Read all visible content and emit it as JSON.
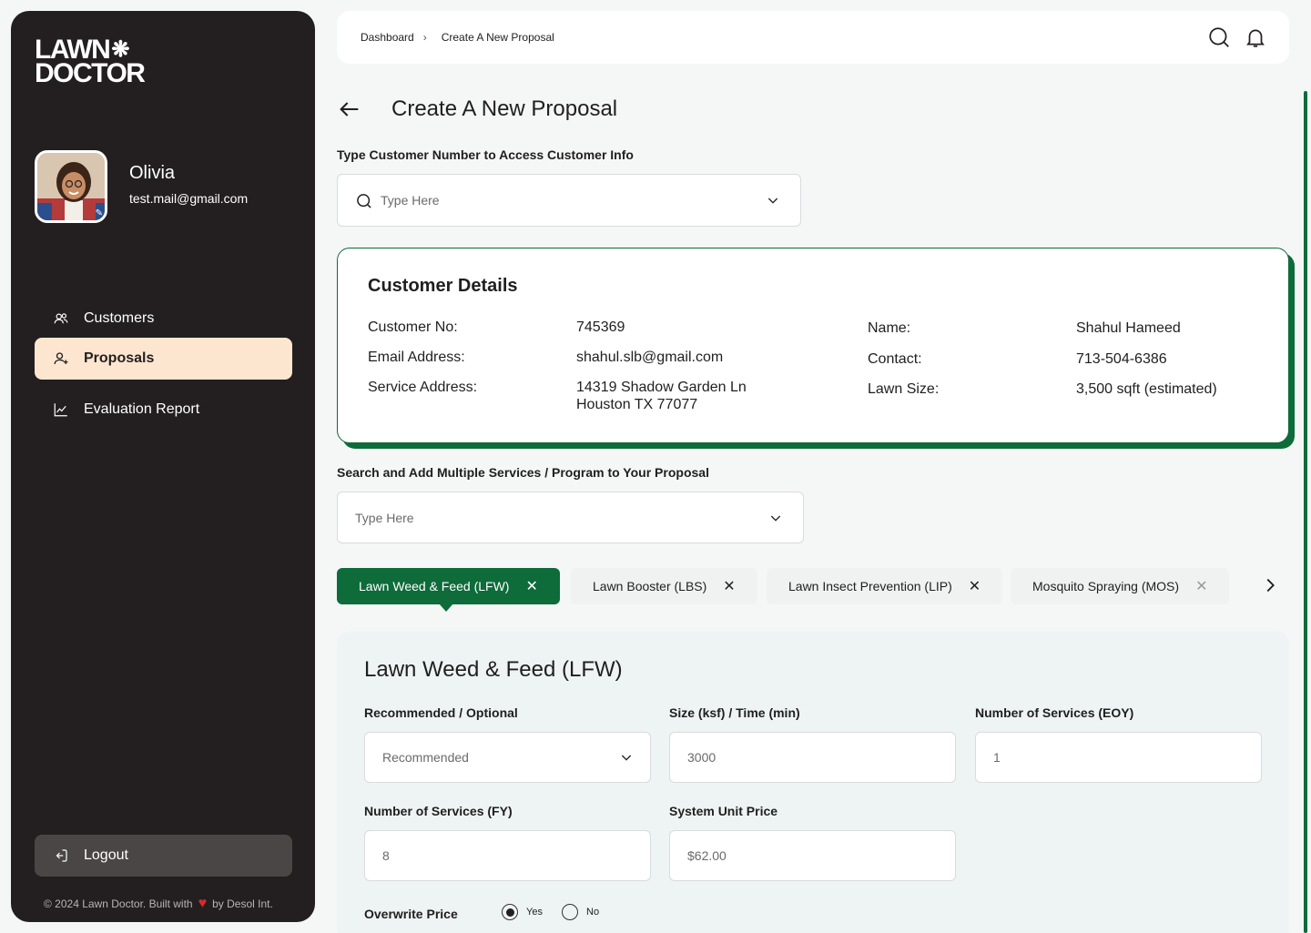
{
  "brand": {
    "logo_line1": "LAWN",
    "logo_line2": "DOCTOR",
    "accent": "#0e6b3a",
    "sidebar_bg": "#231f20",
    "active_nav_bg": "#fde6cf"
  },
  "user": {
    "name": "Olivia",
    "email": "test.mail@gmail.com"
  },
  "nav": {
    "items": [
      {
        "label": "Customers",
        "icon": "users-icon"
      },
      {
        "label": "Proposals",
        "icon": "user-plus-icon",
        "active": true
      },
      {
        "label": "Evaluation Report",
        "icon": "chart-line-icon"
      }
    ],
    "logout_label": "Logout"
  },
  "footer": {
    "prefix": "© 2024 Lawn Doctor. Built with",
    "suffix": "by Desol Int."
  },
  "breadcrumb": [
    "Dashboard",
    "Create A New Proposal"
  ],
  "page": {
    "title": "Create A New Proposal"
  },
  "customer_search": {
    "label": "Type Customer Number to Access Customer Info",
    "placeholder": "Type Here"
  },
  "customer": {
    "title": "Customer Details",
    "labels": {
      "number": "Customer No:",
      "email": "Email Address:",
      "address": "Service Address:",
      "name": "Name:",
      "contact": "Contact:",
      "lawn": "Lawn Size:"
    },
    "values": {
      "number": "745369",
      "email": "shahul.slb@gmail.com",
      "address_line1": "14319 Shadow Garden Ln",
      "address_line2": "Houston TX 77077",
      "name": "Shahul Hameed",
      "contact": "713-504-6386",
      "lawn": "3,500 sqft (estimated)"
    }
  },
  "service_search": {
    "label": "Search and Add Multiple Services / Program to Your Proposal",
    "placeholder": "Type Here"
  },
  "tabs": [
    "Lawn Weed & Feed (LFW)",
    "Lawn Booster (LBS)",
    "Lawn Insect Prevention (LIP)",
    "Mosquito Spraying (MOS)"
  ],
  "service_panel": {
    "title": "Lawn Weed & Feed (LFW)",
    "fields": {
      "rec_label": "Recommended / Optional",
      "rec_value": "Recommended",
      "size_label": "Size (ksf) / Time (min)",
      "size_value": "3000",
      "eoy_label": "Number of Services (EOY)",
      "eoy_value": "1",
      "fy_label": "Number of Services (FY)",
      "fy_value": "8",
      "price_label": "System Unit Price",
      "price_value": "$62.00"
    },
    "overwrite": {
      "label": "Overwrite Price",
      "yes": "Yes",
      "no": "No",
      "selected": "Yes"
    }
  }
}
